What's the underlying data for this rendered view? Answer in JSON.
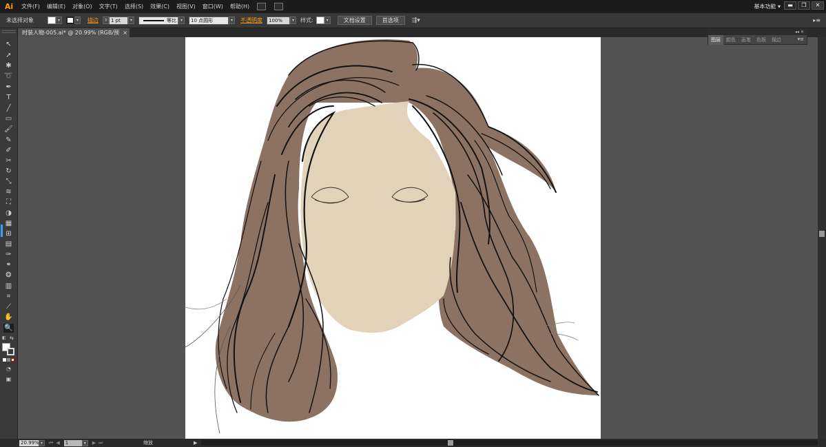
{
  "app": {
    "logo": "Ai"
  },
  "menu": [
    "文件(F)",
    "编辑(E)",
    "对象(O)",
    "文字(T)",
    "选择(S)",
    "效果(C)",
    "视图(V)",
    "窗口(W)",
    "帮助(H)"
  ],
  "workspace": "基本功能 ▾",
  "window_buttons": [
    "▬",
    "❐",
    "✕"
  ],
  "control": {
    "selection_status": "未选择对象",
    "stroke_label": "描边",
    "stroke_weight": "1 pt",
    "stroke_profile": "等比",
    "brush": "10 点圆形",
    "opacity_label": "不透明度",
    "opacity": "100%",
    "style_label": "样式:",
    "doc_setup": "文档设置",
    "preferences": "首选项",
    "collapse": "▸≡"
  },
  "document_tab": {
    "title": "时装人物-005.ai* @ 20.99% (RGB/预览)",
    "close": "×"
  },
  "panel": {
    "header": "◂◂ ✕",
    "tabs": [
      "图层",
      "颜色",
      "画笔",
      "色板",
      "描边"
    ],
    "menu": "▾≡"
  },
  "status": {
    "zoom": "20.99%",
    "page": "1",
    "tool_name": "缩放"
  },
  "colors": {
    "hair": "#8c7263",
    "face": "#e3d2ba",
    "line": "#111111",
    "accent": "#ff9a1a",
    "canvas": "#535353"
  },
  "tools": [
    "selection-tool",
    "direct-selection-tool",
    "magic-wand-tool",
    "lasso-tool",
    "pen-tool",
    "type-tool",
    "line-tool",
    "rectangle-tool",
    "paintbrush-tool",
    "pencil-tool",
    "blob-brush-tool",
    "scissors-tool",
    "rotate-tool",
    "scale-tool",
    "warp-tool",
    "free-transform-tool",
    "shape-builder-tool",
    "perspective-grid-tool",
    "mesh-tool",
    "gradient-tool",
    "eyedropper-tool",
    "blend-tool",
    "symbol-sprayer-tool",
    "column-graph-tool",
    "artboard-tool",
    "slice-tool",
    "hand-tool",
    "zoom-tool"
  ]
}
